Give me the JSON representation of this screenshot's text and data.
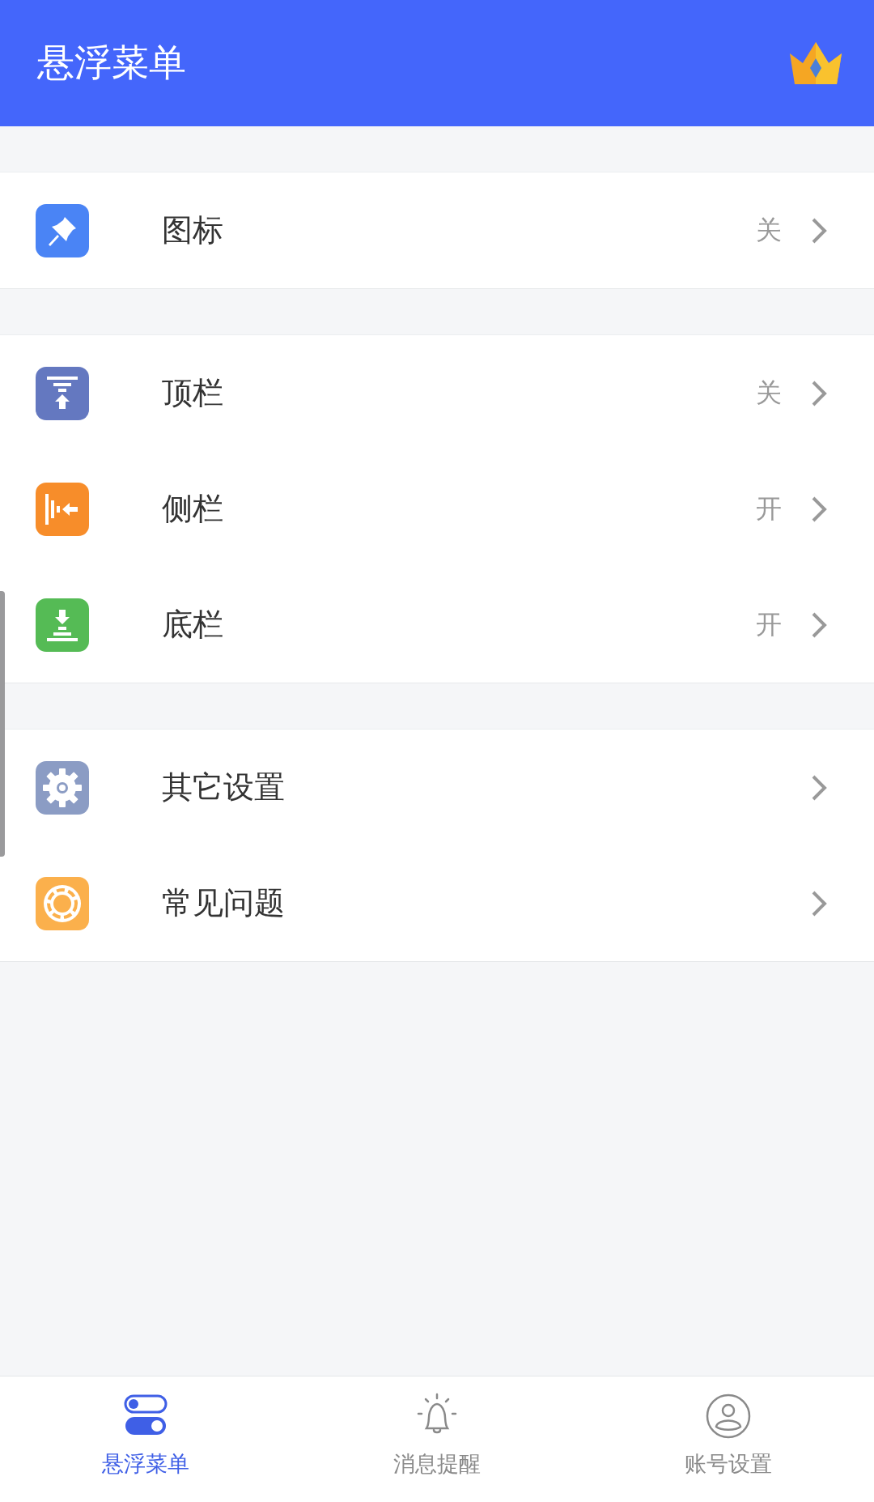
{
  "header": {
    "title": "悬浮菜单"
  },
  "groups": [
    {
      "items": [
        {
          "kind": "pin",
          "color": "#4a84f5",
          "label": "图标",
          "value": "关"
        }
      ]
    },
    {
      "items": [
        {
          "kind": "topbar",
          "color": "#6478c0",
          "label": "顶栏",
          "value": "关"
        },
        {
          "kind": "sidebar",
          "color": "#f78d2a",
          "label": "侧栏",
          "value": "开"
        },
        {
          "kind": "bottombar",
          "color": "#55bb55",
          "label": "底栏",
          "value": "开"
        }
      ]
    },
    {
      "items": [
        {
          "kind": "gear",
          "color": "#8b9cc4",
          "label": "其它设置"
        },
        {
          "kind": "lifebuoy",
          "color": "#fbb04c",
          "label": "常见问题"
        }
      ]
    }
  ],
  "tabs": [
    {
      "kind": "toggles",
      "label": "悬浮菜单",
      "selected": true
    },
    {
      "kind": "bell",
      "label": "消息提醒",
      "selected": false
    },
    {
      "kind": "person",
      "label": "账号设置",
      "selected": false
    }
  ]
}
